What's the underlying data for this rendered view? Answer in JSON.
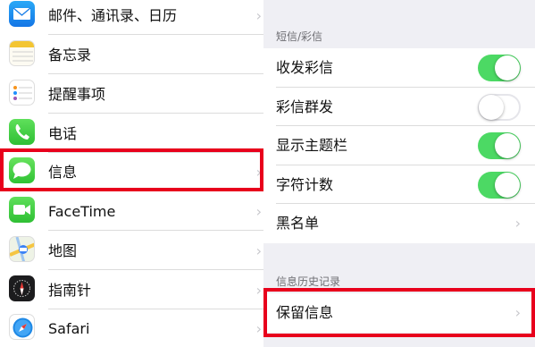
{
  "settings_list": [
    {
      "label": "邮件、通讯录、日历",
      "icon": "mail-icon"
    },
    {
      "label": "备忘录",
      "icon": "notes-icon"
    },
    {
      "label": "提醒事项",
      "icon": "reminders-icon"
    },
    {
      "label": "电话",
      "icon": "phone-icon"
    },
    {
      "label": "信息",
      "icon": "messages-icon"
    },
    {
      "label": "FaceTime",
      "icon": "facetime-icon"
    },
    {
      "label": "地图",
      "icon": "maps-icon"
    },
    {
      "label": "指南针",
      "icon": "compass-icon"
    },
    {
      "label": "Safari",
      "icon": "safari-icon"
    }
  ],
  "chevron": "›",
  "sms_mms": {
    "header": "短信/彩信",
    "rows": [
      {
        "label": "收发彩信",
        "toggle": true
      },
      {
        "label": "彩信群发",
        "toggle": false
      },
      {
        "label": "显示主题栏",
        "toggle": true
      },
      {
        "label": "字符计数",
        "toggle": true
      },
      {
        "label": "黑名单"
      }
    ]
  },
  "history": {
    "header": "信息历史记录",
    "rows": [
      {
        "label": "保留信息"
      }
    ]
  },
  "colors": {
    "toggle_on": "#4cd964",
    "highlight": "#e8001c"
  }
}
